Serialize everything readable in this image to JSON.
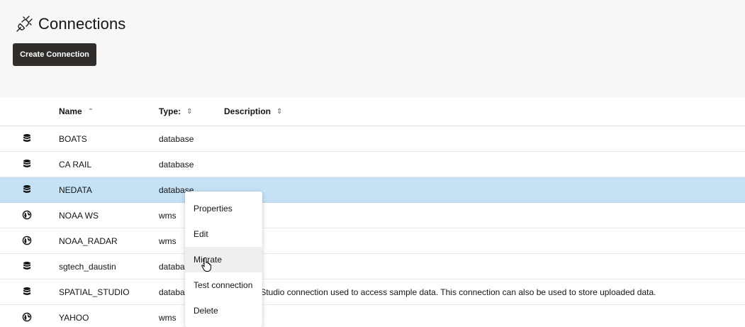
{
  "header": {
    "icon": "plug-icon",
    "title": "Connections",
    "create_button_label": "Create Connection"
  },
  "table": {
    "columns": [
      {
        "label": "Name",
        "sort": "ascending"
      },
      {
        "label": "Type:",
        "sort": "none"
      },
      {
        "label": "Description",
        "sort": "none"
      }
    ],
    "rows": [
      {
        "icon": "database-icon",
        "name": "BOATS",
        "type": "database",
        "description": "",
        "selected": false
      },
      {
        "icon": "database-icon",
        "name": "CA RAIL",
        "type": "database",
        "description": "",
        "selected": false
      },
      {
        "icon": "database-icon",
        "name": "NEDATA",
        "type": "database",
        "description": "",
        "selected": true
      },
      {
        "icon": "globe-icon",
        "name": "NOAA WS",
        "type": "wms",
        "description": "",
        "selected": false
      },
      {
        "icon": "globe-icon",
        "name": "NOAA_RADAR",
        "type": "wms",
        "description": "",
        "selected": false
      },
      {
        "icon": "database-icon",
        "name": "sgtech_daustin",
        "type": "databa",
        "description": "",
        "selected": false
      },
      {
        "icon": "database-icon",
        "name": "SPATIAL_STUDIO",
        "type": "databa",
        "description": "atial Studio connection used to access sample data. This connection can also be used to store uploaded data.",
        "selected": false
      },
      {
        "icon": "globe-icon",
        "name": "YAHOO",
        "type": "wms",
        "description": "",
        "selected": false
      }
    ]
  },
  "context_menu": {
    "items": [
      {
        "label": "Properties"
      },
      {
        "label": "Edit"
      },
      {
        "label": "Migrate",
        "hovered": true
      },
      {
        "label": "Test connection"
      },
      {
        "label": "Delete"
      }
    ]
  },
  "colors": {
    "selected_row": "#c5e2f5",
    "primary_button": "#312d2a",
    "header_background": "#f7f7f7"
  }
}
